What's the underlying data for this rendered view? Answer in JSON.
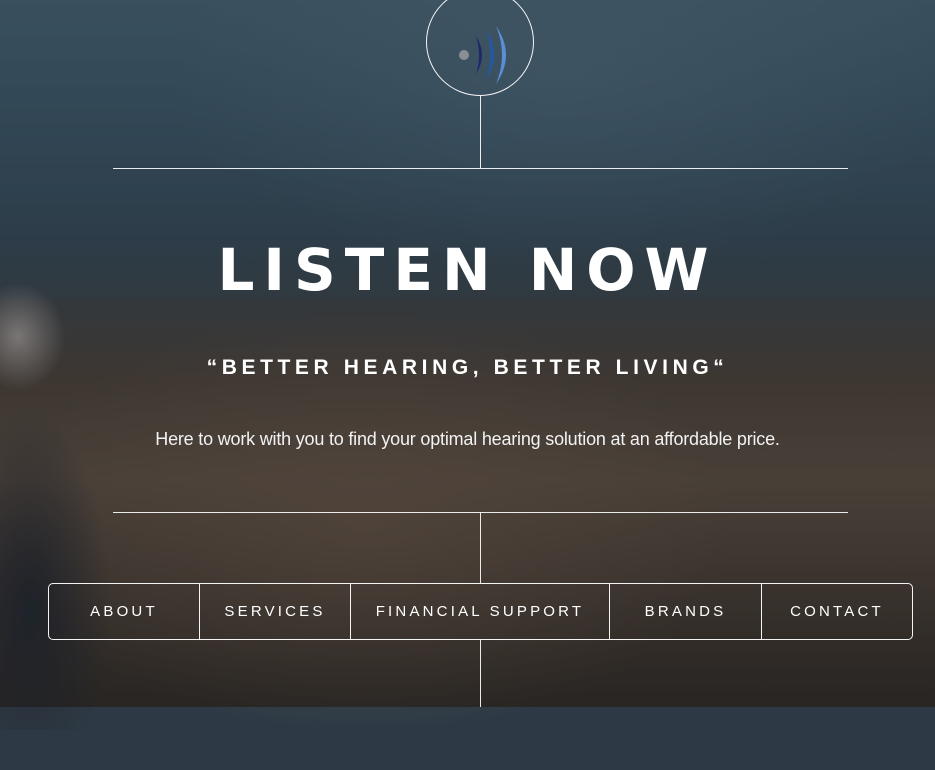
{
  "hero": {
    "title": "LISTEN NOW",
    "tagline": "“BETTER HEARING, BETTER LIVING“",
    "description": "Here to work with you to find your optimal hearing solution at an affordable price."
  },
  "logo": {
    "icon": "sound-waves-logo-icon",
    "colors": {
      "dot": "#8a8f96",
      "wave1": "#1b2a6b",
      "wave2": "#2357a8",
      "wave3": "#5a8fd6"
    }
  },
  "nav": {
    "items": [
      {
        "label": "ABOUT"
      },
      {
        "label": "SERVICES"
      },
      {
        "label": "FINANCIAL SUPPORT"
      },
      {
        "label": "BRANDS"
      },
      {
        "label": "CONTACT"
      }
    ]
  }
}
